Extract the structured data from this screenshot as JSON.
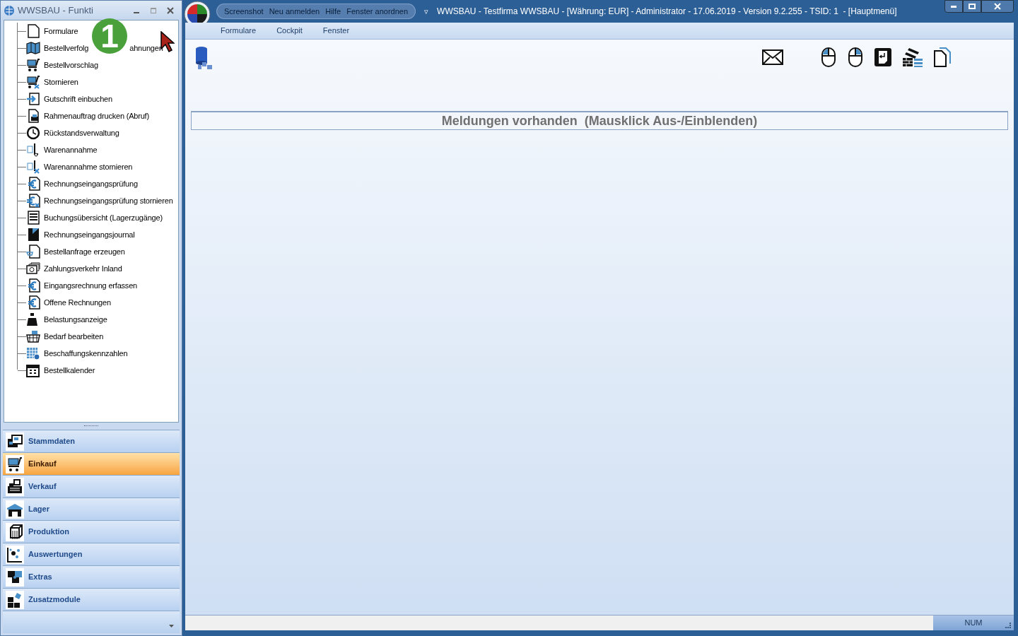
{
  "side_window": {
    "title": "WWSBAU - Funkti",
    "step_badge": "1"
  },
  "tree": [
    {
      "label": "Formulare"
    },
    {
      "label": "Bestellverfolg",
      "label_tail": "ahnungen"
    },
    {
      "label": "Bestellvorschlag"
    },
    {
      "label": "Stornieren"
    },
    {
      "label": "Gutschrift einbuchen"
    },
    {
      "label": "Rahmenauftrag drucken (Abruf)"
    },
    {
      "label": "Rückstandsverwaltung"
    },
    {
      "label": "Warenannahme"
    },
    {
      "label": "Warenannahme stornieren"
    },
    {
      "label": "Rechnungseingangsprüfung"
    },
    {
      "label": "Rechnungseingangsprüfung stornieren"
    },
    {
      "label": "Buchungsübersicht (Lagerzugänge)"
    },
    {
      "label": "Rechnungseingangsjournal"
    },
    {
      "label": "Bestellanfrage erzeugen"
    },
    {
      "label": "Zahlungsverkehr Inland"
    },
    {
      "label": "Eingangsrechnung erfassen"
    },
    {
      "label": "Offene Rechnungen"
    },
    {
      "label": "Belastungsanzeige"
    },
    {
      "label": "Bedarf bearbeiten"
    },
    {
      "label": "Beschaffungskennzahlen"
    },
    {
      "label": "Bestellkalender"
    }
  ],
  "nav": [
    {
      "label": "Stammdaten",
      "selected": false
    },
    {
      "label": "Einkauf",
      "selected": true
    },
    {
      "label": "Verkauf",
      "selected": false
    },
    {
      "label": "Lager",
      "selected": false
    },
    {
      "label": "Produktion",
      "selected": false
    },
    {
      "label": "Auswertungen",
      "selected": false
    },
    {
      "label": "Extras",
      "selected": false
    },
    {
      "label": "Zusatzmodule",
      "selected": false
    }
  ],
  "main_window": {
    "quick_access": [
      "Screenshot",
      "Neu anmelden",
      "Hilfe",
      "Fenster anordnen"
    ],
    "quick_access_dropdown": "▿",
    "title": "WWSBAU - Testfirma WWSBAU - [Währung: EUR] - Administrator - 17.06.2019 - Version 9.2.255 - TSID: 1  - [Hauptmenü]"
  },
  "menu": [
    "Formulare",
    "Cockpit",
    "Fenster"
  ],
  "messages_bar": "Meldungen vorhanden  (Mausklick Aus-/Einblenden)",
  "status_bar": {
    "num": "NUM"
  }
}
